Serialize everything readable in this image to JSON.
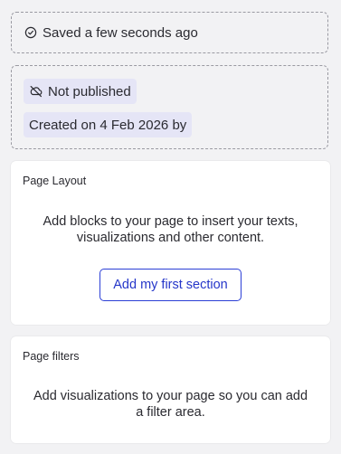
{
  "save_status": {
    "icon": "check-circle-icon",
    "text": "Saved a few seconds ago"
  },
  "publish_info": {
    "status_icon": "cloud-off-icon",
    "status_text": "Not published",
    "created_text": "Created on 4 Feb 2026 by"
  },
  "page_layout": {
    "heading": "Page Layout",
    "description": "Add blocks to your page to insert your texts, visualizations and other content.",
    "add_button_label": "Add my first section"
  },
  "page_filters": {
    "heading": "Page filters",
    "description": "Add visualizations to your page so you can add a filter area."
  },
  "colors": {
    "background": "#f2f2f4",
    "pill_background": "#e5e5f6",
    "accent": "#2b3fd6"
  }
}
